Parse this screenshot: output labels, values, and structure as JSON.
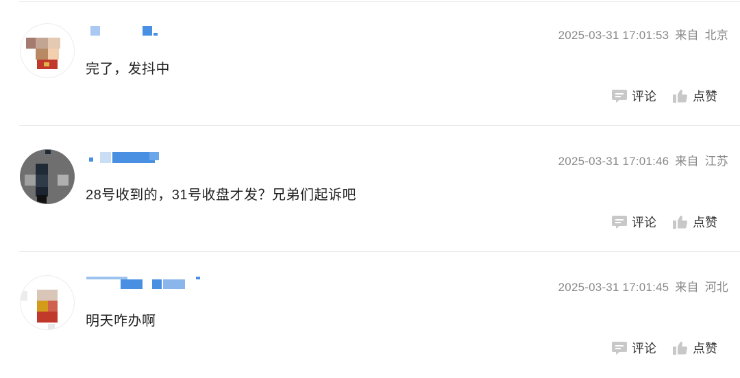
{
  "comments": [
    {
      "text": "完了，发抖中",
      "time": "2025-03-31 17:01:53",
      "from_label": "来自",
      "location": "北京",
      "comment_label": "评论",
      "like_label": "点赞"
    },
    {
      "text": "28号收到的，31号收盘才发？兄弟们起诉吧",
      "time": "2025-03-31 17:01:46",
      "from_label": "来自",
      "location": "江苏",
      "comment_label": "评论",
      "like_label": "点赞"
    },
    {
      "text": "明天咋办啊",
      "time": "2025-03-31 17:01:45",
      "from_label": "来自",
      "location": "河北",
      "comment_label": "评论",
      "like_label": "点赞"
    }
  ],
  "colors": {
    "username_blue": "#4a90e2",
    "meta_gray": "#8a8a8a",
    "icon_gray": "#c8c8c8"
  },
  "icons": {
    "comment": "speech-bubble-icon",
    "like": "thumbs-up-icon"
  }
}
